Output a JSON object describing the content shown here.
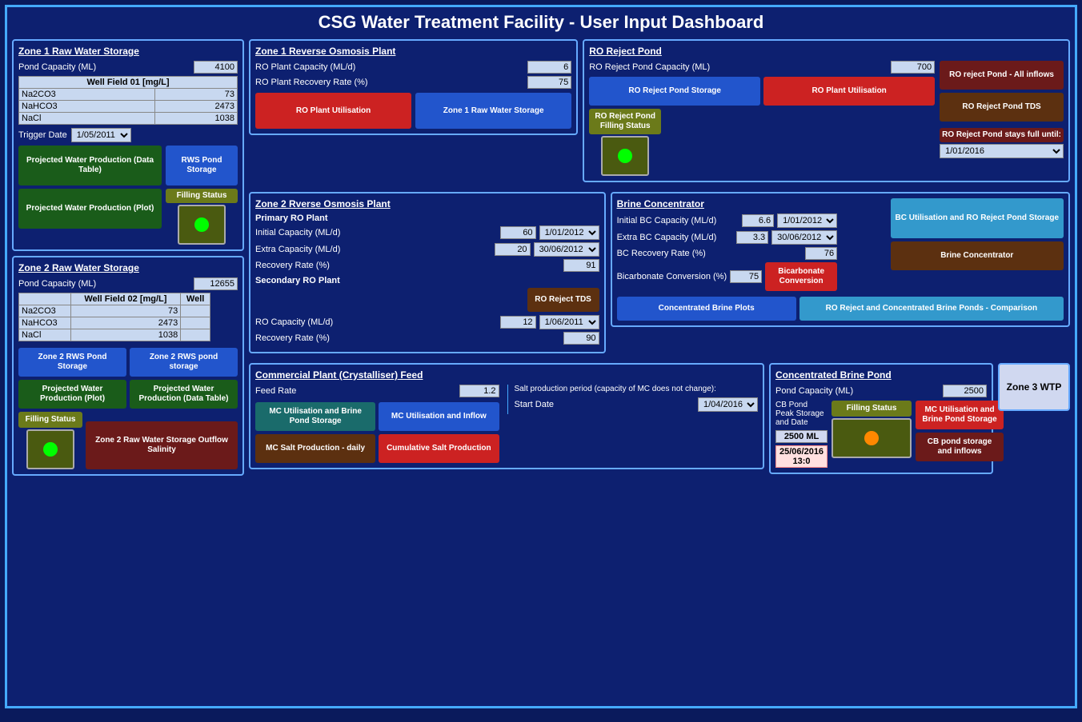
{
  "page": {
    "title": "CSG Water Treatment Facility - User Input Dashboard"
  },
  "zone1_rws": {
    "title": "Zone 1 Raw Water Storage",
    "pond_capacity_label": "Pond Capacity (ML)",
    "pond_capacity_value": "4100",
    "table_header": "Well Field 01 [mg/L]",
    "rows": [
      {
        "name": "Na2CO3",
        "value": "73"
      },
      {
        "name": "NaHCO3",
        "value": "2473"
      },
      {
        "name": "NaCl",
        "value": "1038"
      }
    ],
    "trigger_date_label": "Trigger Date",
    "trigger_date_value": "1/05/2011",
    "btn_projected_water_prod_table": "Projected Water Production (Data Table)",
    "btn_rws_pond_storage": "RWS Pond Storage",
    "btn_projected_water_prod_plot": "Projected Water Production (Plot)",
    "btn_filling_status": "Filling Status"
  },
  "zone1_ro": {
    "title": "Zone 1 Reverse Osmosis Plant",
    "capacity_label": "RO Plant Capacity (ML/d)",
    "capacity_value": "6",
    "recovery_label": "RO Plant Recovery Rate (%)",
    "recovery_value": "75",
    "btn_ro_plant_util": "RO Plant Utilisation",
    "btn_zone1_rws": "Zone 1 Raw Water Storage"
  },
  "ro_reject_pond": {
    "title": "RO Reject Pond",
    "capacity_label": "RO Reject Pond Capacity (ML)",
    "capacity_value": "700",
    "btn_storage": "RO Reject Pond Storage",
    "btn_ro_plant_util": "RO Plant Utilisation",
    "btn_filling_status": "RO Reject Pond Filling Status",
    "btn_all_inflows": "RO reject Pond - All inflows",
    "btn_tds": "RO Reject Pond TDS",
    "btn_stays_full": "RO Reject Pond stays full until:",
    "stays_full_date": "1/01/2016"
  },
  "zone2_rws": {
    "title": "Zone 2 Raw Water Storage",
    "pond_capacity_label": "Pond Capacity (ML)",
    "pond_capacity_value": "12655",
    "table_header1": "Well Field 02 [mg/L]",
    "table_header2": "Well",
    "rows": [
      {
        "name": "Na2CO3",
        "value": "73"
      },
      {
        "name": "NaHCO3",
        "value": "2473"
      },
      {
        "name": "NaCl",
        "value": "1038"
      }
    ],
    "btn_zone2_rws_storage": "Zone 2 RWS Pond Storage",
    "btn_zone2_rws_pond": "Zone 2 RWS pond storage",
    "btn_proj_water_plot": "Projected Water Production (Plot)",
    "btn_proj_water_table": "Projected Water Production (Data Table)",
    "btn_filling_status": "Filling Status",
    "btn_zone2_outflow": "Zone 2 Raw Water Storage Outflow Salinity"
  },
  "zone2_ro": {
    "title": "Zone 2 Rverse Osmosis Plant",
    "primary_label": "Primary RO Plant",
    "initial_cap_label": "Initial Capacity (ML/d)",
    "initial_cap_value": "60",
    "initial_cap_date": "1/01/2012",
    "extra_cap_label": "Extra Capacity (ML/d)",
    "extra_cap_value": "20",
    "extra_cap_date": "30/06/2012",
    "recovery_label": "Recovery Rate (%)",
    "recovery_value": "91",
    "secondary_label": "Secondary RO Plant",
    "btn_ro_reject_tds": "RO Reject TDS",
    "sec_cap_label": "RO Capacity (ML/d)",
    "sec_cap_value": "12",
    "sec_cap_date": "1/06/2011",
    "sec_recovery_label": "Recovery Rate (%)",
    "sec_recovery_value": "90"
  },
  "brine_concentrator": {
    "title": "Brine Concentrator",
    "initial_cap_label": "Initial BC Capacity (ML/d)",
    "initial_cap_value": "6.6",
    "initial_cap_date": "1/01/2012",
    "extra_cap_label": "Extra BC Capacity (ML/d)",
    "extra_cap_value": "3.3",
    "extra_cap_date": "30/06/2012",
    "bc_recovery_label": "BC Recovery Rate (%)",
    "bc_recovery_value": "76",
    "bicarb_label": "Bicarbonate Conversion (%)",
    "bicarb_value": "75",
    "btn_bc_util": "BC Utilisation and RO Reject Pond Storage",
    "btn_brine_conc": "Brine Concentrator",
    "btn_bicarb_conv": "Bicarbonate Conversion",
    "btn_conc_brine_plots": "Concentrated Brine Plots",
    "btn_ro_reject_comp": "RO Reject and Concentrated Brine Ponds - Comparison"
  },
  "concentrated_brine_pond": {
    "title": "Concentrated Brine Pond",
    "capacity_label": "Pond Capacity (ML)",
    "capacity_value": "2500",
    "cb_peak_label": "CB Pond Peak Storage and Date",
    "btn_filling_status": "Filling Status",
    "value_ml": "2500 ML",
    "value_date": "25/06/2016 13:0",
    "btn_mc_util": "MC Utilisation and Brine Pond Storage",
    "btn_cb_storage": "CB pond storage and inflows"
  },
  "commercial_plant": {
    "title": "Commercial Plant (Crystalliser) Feed",
    "feed_rate_label": "Feed Rate",
    "feed_rate_value": "1.2",
    "salt_prod_label": "Salt production period (capacity of MC does not change):",
    "start_date_label": "Start Date",
    "start_date_value": "1/04/2016",
    "btn_mc_util_brine": "MC Utilisation and Brine Pond Storage",
    "btn_mc_util_inflow": "MC Utilisation and Inflow",
    "btn_mc_salt_daily": "MC Salt Production - daily",
    "btn_cumulative_salt": "Cumulative Salt Production"
  },
  "zone3_wtp": {
    "label": "Zone 3 WTP"
  }
}
